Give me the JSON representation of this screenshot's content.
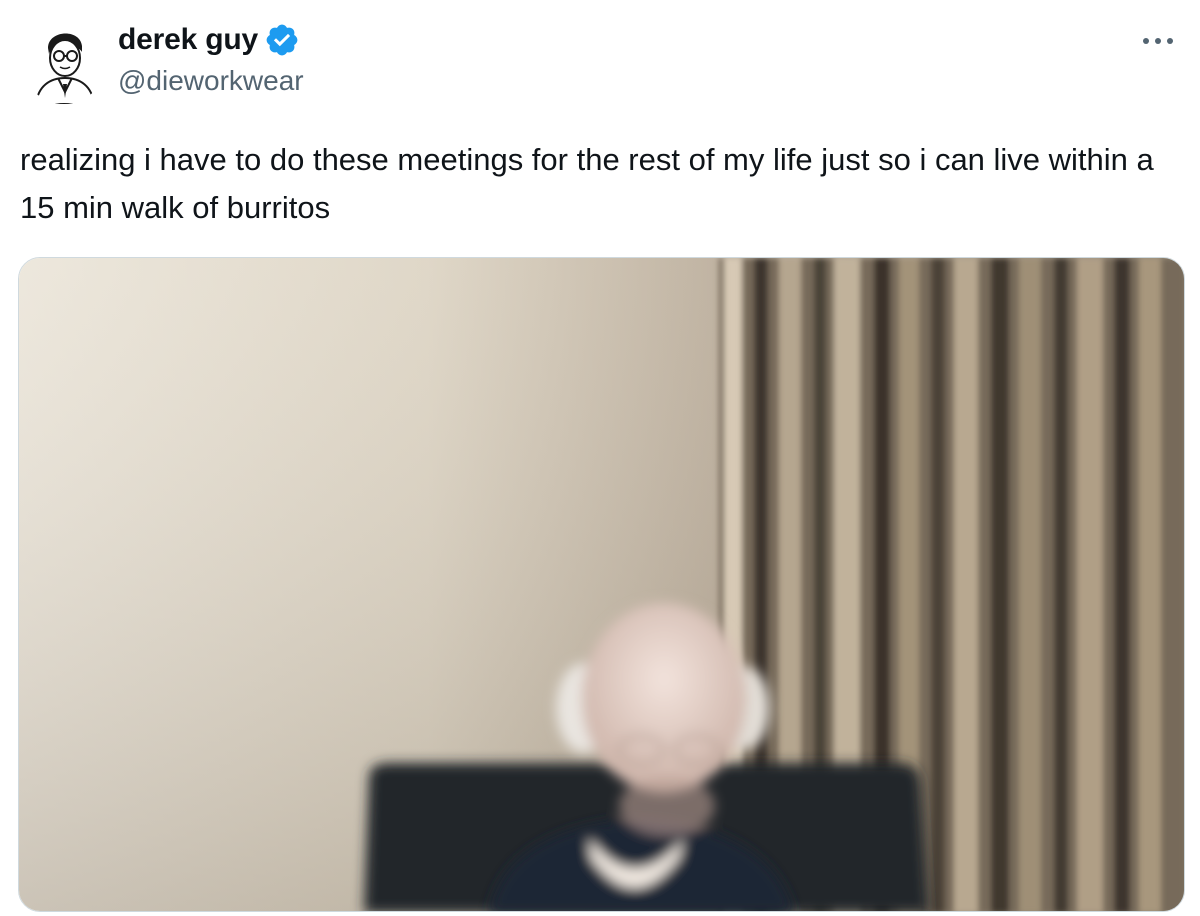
{
  "author": {
    "display_name": "derek guy",
    "handle": "@dieworkwear",
    "verified": true,
    "verified_badge_color": "#1d9bf0",
    "avatar_icon": "man-with-glasses-portrait-icon"
  },
  "actions": {
    "more_icon": "more-options-icon"
  },
  "tweet": {
    "text": "realizing i have to do these meetings for the rest of my life just so i can live within a 15 min walk of burritos"
  },
  "media": {
    "type": "photo",
    "colors": {
      "wall": "#e3dccd",
      "curtain": "#7d7160",
      "chair": "#1f2226",
      "shirt": "#1e2433",
      "head": "#e6d3cb"
    }
  },
  "colors": {
    "text_primary": "#0f1419",
    "text_secondary": "#536471",
    "border": "#cfd9de"
  }
}
